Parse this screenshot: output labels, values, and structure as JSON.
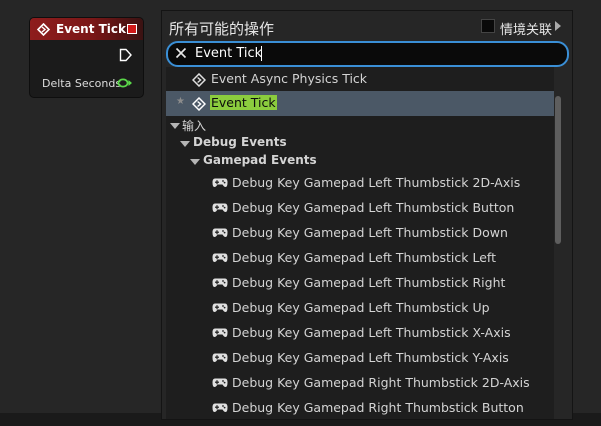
{
  "node": {
    "title": "Event Tick",
    "output_pin_label": "Delta Seconds",
    "header_color": "#8e1d1d",
    "float_pin_color": "#5bd84a",
    "delegate_pin_color": "#d01818"
  },
  "menu": {
    "title": "所有可能的操作",
    "context_label": "情境关联",
    "context_checked": false,
    "search": {
      "value": "Event Tick",
      "placeholder": ""
    },
    "actions": [
      {
        "label": "Event Async Physics Tick",
        "icon": "event-icon",
        "selected": false,
        "favorite": false
      },
      {
        "label": "Event Tick",
        "icon": "event-icon",
        "selected": true,
        "favorite": true,
        "highlight": "Event Tick"
      }
    ],
    "category_input": "输入",
    "category_debug_events": "Debug Events",
    "category_gamepad_events": "Gamepad Events",
    "gamepad_items": [
      {
        "label": "Debug Key Gamepad Left Thumbstick 2D-Axis",
        "icon": "gamepad-icon"
      },
      {
        "label": "Debug Key Gamepad Left Thumbstick Button",
        "icon": "gamepad-icon"
      },
      {
        "label": "Debug Key Gamepad Left Thumbstick Down",
        "icon": "gamepad-icon"
      },
      {
        "label": "Debug Key Gamepad Left Thumbstick Left",
        "icon": "gamepad-icon"
      },
      {
        "label": "Debug Key Gamepad Left Thumbstick Right",
        "icon": "gamepad-icon"
      },
      {
        "label": "Debug Key Gamepad Left Thumbstick Up",
        "icon": "gamepad-icon"
      },
      {
        "label": "Debug Key Gamepad Left Thumbstick X-Axis",
        "icon": "gamepad-icon"
      },
      {
        "label": "Debug Key Gamepad Left Thumbstick Y-Axis",
        "icon": "gamepad-icon"
      },
      {
        "label": "Debug Key Gamepad Right Thumbstick 2D-Axis",
        "icon": "gamepad-icon"
      },
      {
        "label": "Debug Key Gamepad Right Thumbstick Button",
        "icon": "gamepad-icon"
      }
    ],
    "highlight_color": "#8bcc3e",
    "selection_color": "#4b5866",
    "search_border_color": "#3a8fd6"
  }
}
